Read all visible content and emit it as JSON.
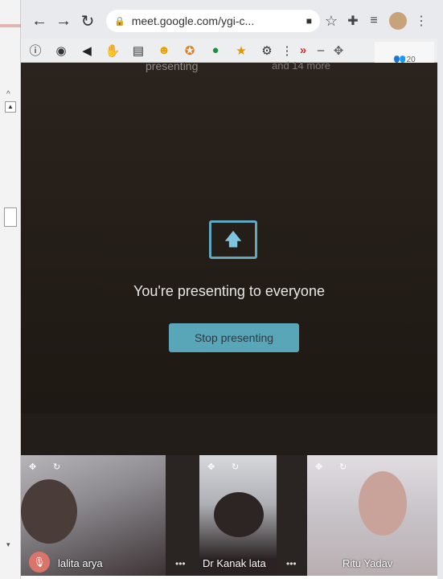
{
  "browser": {
    "url": "meet.google.com/ygi-c...",
    "icons": [
      "back-icon",
      "forward-icon",
      "reload-icon",
      "lock-icon",
      "camera-icon",
      "star-icon",
      "extensions-icon",
      "media-icon",
      "profile-avatar",
      "menu-icon"
    ]
  },
  "extensions": {
    "icons": [
      "info-icon",
      "eye-icon",
      "speaker-icon",
      "hand-icon",
      "note-icon",
      "emoji-icon",
      "badge-icon",
      "chat-icon",
      "favorite-icon",
      "settings-icon",
      "more-icon",
      "chevron-icon",
      "minimize-icon",
      "move-icon"
    ]
  },
  "meet": {
    "top_left_text": "presenting",
    "top_right_text": "and 14 more",
    "people_count": "20",
    "present_message": "You're presenting to everyone",
    "stop_button": "Stop presenting",
    "accent_color": "#5aa6b9"
  },
  "participants": [
    {
      "name": "lalita arya",
      "muted": true
    },
    {
      "name": "Dr Kanak lata",
      "muted": false
    },
    {
      "name": "Ritu Yadav",
      "muted": false
    }
  ]
}
